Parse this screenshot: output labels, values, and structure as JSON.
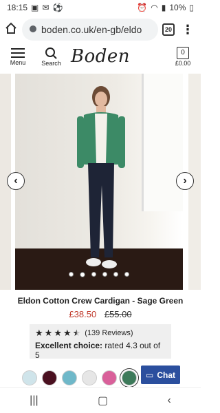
{
  "status": {
    "time": "18:15",
    "battery": "10%"
  },
  "browser": {
    "url": "boden.co.uk/en-gb/eldo",
    "tab_count": "20"
  },
  "header": {
    "menu_label": "Menu",
    "search_label": "Search",
    "logo": "Boden",
    "bag_count": "0",
    "bag_total": "£0.00"
  },
  "product": {
    "title": "Eldon Cotton Crew Cardigan - Sage Green",
    "sale_price": "£38.50",
    "was_price": "£55.00",
    "review_count_text": "(139 Reviews)",
    "excellent_label": "Excellent choice:",
    "rating_text": "rated 4.3 out of 5",
    "rating": 4.3
  },
  "gallery": {
    "image_count": 6,
    "active_index": 1
  },
  "swatches": [
    {
      "name": "light-blue-pattern",
      "color": "#cfe4ea"
    },
    {
      "name": "burgundy-pattern",
      "color": "#4a1020"
    },
    {
      "name": "turquoise-pattern",
      "color": "#6fb8c9"
    },
    {
      "name": "grey-pattern",
      "color": "#e6e6e6"
    },
    {
      "name": "pink",
      "color": "#d9609a"
    },
    {
      "name": "sage-green",
      "color": "#3d7a5a"
    }
  ],
  "chat": {
    "label": "Chat"
  }
}
